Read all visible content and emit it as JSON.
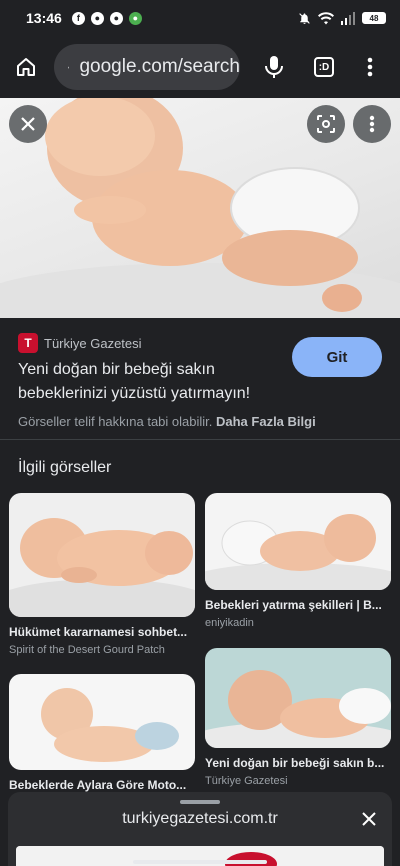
{
  "status_bar": {
    "time": "13:46",
    "battery": "48"
  },
  "toolbar": {
    "url": "google.com/search",
    "tabs_label": ":D"
  },
  "source": {
    "name": "Türkiye Gazetesi",
    "logo_letter": "T",
    "headline": "Yeni doğan bir bebeği sakın bebeklerinizi yüzüstü yatırmayın!",
    "visit_label": "Git",
    "copyright_text": "Görseller telif hakkına tabi olabilir.",
    "more_info_label": "Daha Fazla Bilgi"
  },
  "related": {
    "title": "İlgili görseller",
    "items": [
      {
        "title": "Hükümet kararnamesi sohbet...",
        "source": "Spirit of the Desert Gourd Patch"
      },
      {
        "title": "Bebekleri yatırma şekilleri | B...",
        "source": "eniyikadin"
      },
      {
        "title": "Bebeklerde Aylara Göre Moto...",
        "source": ""
      },
      {
        "title": "Yeni doğan bir bebeği sakın b...",
        "source": "Türkiye Gazetesi"
      }
    ]
  },
  "bottom_sheet": {
    "domain": "turkiyegazetesi.com.tr"
  },
  "colors": {
    "background": "#202124",
    "accent": "#8ab4f8",
    "brand_red": "#c8102e"
  },
  "icons": [
    "home-icon",
    "lock-icon",
    "mic-icon",
    "tabs-icon",
    "menu-icon",
    "close-icon",
    "lens-icon",
    "more-icon"
  ]
}
